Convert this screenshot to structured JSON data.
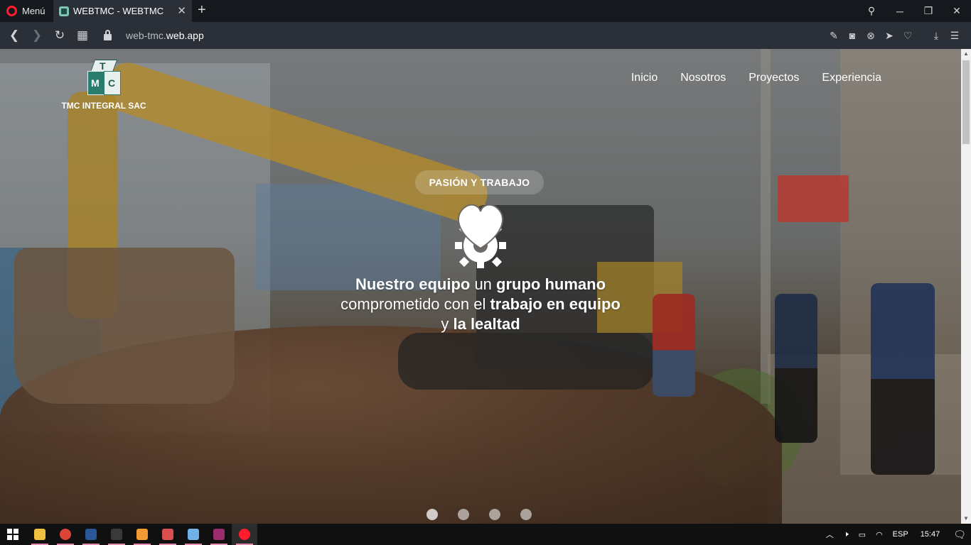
{
  "browser": {
    "menu_label": "Menú",
    "tab_title": "WEBTMC - WEBTMC",
    "url_prefix": "web-tmc.",
    "url_domain": "web.app"
  },
  "site": {
    "brand_name": "TMC INTEGRAL SAC",
    "logo_letters": {
      "top": "T",
      "left": "M",
      "right": "C"
    },
    "nav": [
      "Inicio",
      "Nosotros",
      "Proyectos",
      "Experiencia"
    ],
    "hero": {
      "pill": "PASIÓN Y TRABAJO",
      "tagline": {
        "part1_bold": "Nuestro equipo",
        "part2": " un ",
        "part3_bold": "grupo humano",
        "part4": " comprometido con el ",
        "part5_bold": "trabajo en equipo",
        "part6": " y ",
        "part7_bold": "la lealtad"
      },
      "slides_count": 4,
      "active_slide": 1
    }
  },
  "taskbar": {
    "language": "ESP",
    "time": "15:47",
    "apps": [
      {
        "name": "file-explorer",
        "color": "#f0c040"
      },
      {
        "name": "chrome",
        "color": "#db4437"
      },
      {
        "name": "word",
        "color": "#2b579a"
      },
      {
        "name": "terminal",
        "color": "#3a3a3a"
      },
      {
        "name": "sublime-text",
        "color": "#f29b35"
      },
      {
        "name": "paint-app",
        "color": "#d94f4f"
      },
      {
        "name": "paint-3d",
        "color": "#6fb1e8"
      },
      {
        "name": "winrar",
        "color": "#9b2d6f"
      },
      {
        "name": "opera",
        "color": "#ff1b2d"
      }
    ]
  },
  "colors": {
    "brand_teal": "#2a7d6d",
    "tab_bg": "#2b3038",
    "opera_red": "#ff1b2d"
  }
}
